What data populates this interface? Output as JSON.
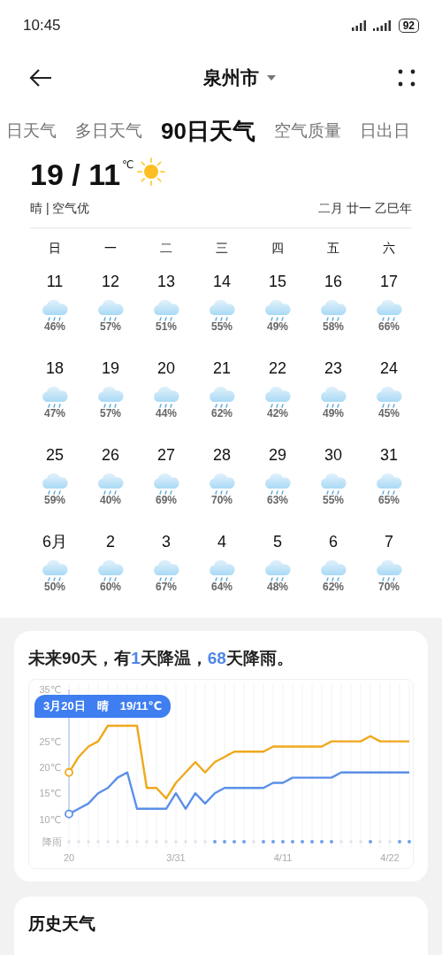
{
  "status_bar": {
    "time": "10:45",
    "battery": "92"
  },
  "header": {
    "title": "泉州市"
  },
  "tabs": [
    {
      "label": "日天气",
      "selected": false
    },
    {
      "label": "多日天气",
      "selected": false
    },
    {
      "label": "90日天气",
      "selected": true
    },
    {
      "label": "空气质量",
      "selected": false
    },
    {
      "label": "日出日",
      "selected": false
    }
  ],
  "today": {
    "temps": "19 / 11",
    "unit": "℃",
    "kind": "sun",
    "condition": "晴 | 空气优",
    "lunar": "二月 廿一 乙巳年"
  },
  "calendar": {
    "weekdays": [
      "日",
      "一",
      "二",
      "三",
      "四",
      "五",
      "六"
    ],
    "days": [
      {
        "day": "11",
        "kind": "rain",
        "chance": "46%"
      },
      {
        "day": "12",
        "kind": "rain",
        "chance": "57%"
      },
      {
        "day": "13",
        "kind": "rain",
        "chance": "51%"
      },
      {
        "day": "14",
        "kind": "rain",
        "chance": "55%"
      },
      {
        "day": "15",
        "kind": "rain",
        "chance": "49%"
      },
      {
        "day": "16",
        "kind": "rain",
        "chance": "58%"
      },
      {
        "day": "17",
        "kind": "rain",
        "chance": "66%"
      },
      {
        "day": "18",
        "kind": "rain",
        "chance": "47%"
      },
      {
        "day": "19",
        "kind": "rain",
        "chance": "57%"
      },
      {
        "day": "20",
        "kind": "rain",
        "chance": "44%"
      },
      {
        "day": "21",
        "kind": "rain",
        "chance": "62%"
      },
      {
        "day": "22",
        "kind": "rain",
        "chance": "42%"
      },
      {
        "day": "23",
        "kind": "rain",
        "chance": "49%"
      },
      {
        "day": "24",
        "kind": "rain",
        "chance": "45%"
      },
      {
        "day": "25",
        "kind": "rain",
        "chance": "59%"
      },
      {
        "day": "26",
        "kind": "rain",
        "chance": "40%"
      },
      {
        "day": "27",
        "kind": "rain",
        "chance": "69%"
      },
      {
        "day": "28",
        "kind": "rain",
        "chance": "70%"
      },
      {
        "day": "29",
        "kind": "rain",
        "chance": "63%"
      },
      {
        "day": "30",
        "kind": "rain",
        "chance": "55%"
      },
      {
        "day": "31",
        "kind": "rain",
        "chance": "65%"
      },
      {
        "day": "6月",
        "kind": "rain",
        "chance": "50%"
      },
      {
        "day": "2",
        "kind": "rain",
        "chance": "60%"
      },
      {
        "day": "3",
        "kind": "rain",
        "chance": "67%"
      },
      {
        "day": "4",
        "kind": "rain",
        "chance": "64%"
      },
      {
        "day": "5",
        "kind": "rain",
        "chance": "48%"
      },
      {
        "day": "6",
        "kind": "rain",
        "chance": "62%"
      },
      {
        "day": "7",
        "kind": "rain",
        "chance": "70%"
      }
    ]
  },
  "forecast": {
    "summary": "未来90天，有**1**天降温，**68**天降雨。",
    "tooltip": "3月20日　晴　19/11℃",
    "rain_label": "降雨",
    "rain": [
      false,
      false,
      false,
      false,
      false,
      false,
      false,
      false,
      false,
      false,
      false,
      false,
      false,
      false,
      false,
      true,
      true,
      true,
      true,
      false,
      true,
      true,
      true,
      true,
      true,
      true,
      true,
      true,
      false,
      false,
      false,
      true,
      false,
      false,
      true,
      true
    ],
    "chart_data": {
      "type": "line",
      "categories": [
        "20",
        null,
        null,
        null,
        null,
        null,
        null,
        null,
        null,
        null,
        null,
        "3/31",
        null,
        null,
        null,
        null,
        null,
        null,
        null,
        null,
        null,
        null,
        "4/11",
        null,
        null,
        null,
        null,
        null,
        null,
        null,
        null,
        null,
        null,
        "4/22",
        null,
        null
      ],
      "ylim": [
        10,
        35
      ],
      "grid": true,
      "yticks": [
        {
          "value": 10,
          "label": "10℃"
        },
        {
          "value": 15,
          "label": "15℃"
        },
        {
          "value": 20,
          "label": "20℃"
        },
        {
          "value": 25,
          "label": "25℃"
        },
        {
          "value": 35,
          "label": "35℃"
        }
      ],
      "series": [
        {
          "color": "#f0a81c",
          "values": [
            19,
            22,
            24,
            25,
            28,
            28,
            28,
            28,
            16,
            16,
            14,
            17,
            19,
            21,
            19,
            21,
            22,
            23,
            23,
            23,
            23,
            24,
            24,
            24,
            24,
            24,
            24,
            25,
            25,
            25,
            25,
            26,
            25,
            25,
            25,
            25
          ]
        },
        {
          "color": "#5b8fe8",
          "values": [
            11,
            12,
            13,
            15,
            16,
            18,
            19,
            12,
            12,
            12,
            12,
            15,
            12,
            15,
            13,
            15,
            16,
            16,
            16,
            16,
            16,
            17,
            17,
            18,
            18,
            18,
            18,
            18,
            19,
            19,
            19,
            19,
            19,
            19,
            19,
            19
          ]
        }
      ]
    }
  },
  "history": {
    "title": "历史天气"
  }
}
